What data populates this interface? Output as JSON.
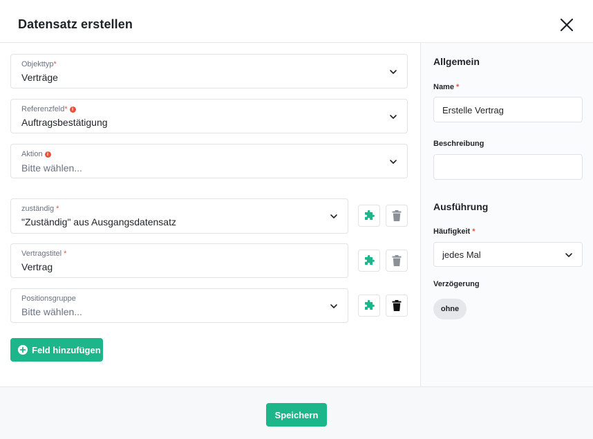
{
  "dialog": {
    "title": "Datensatz erstellen"
  },
  "left": {
    "fields": [
      {
        "label": "Objekttyp",
        "required": "*",
        "value": "Verträge"
      },
      {
        "label": "Referenzfeld",
        "required": "*",
        "info": "i",
        "value": "Auftragsbestätigung"
      },
      {
        "label": "Aktion",
        "info": "i",
        "value": "Bitte wählen..."
      },
      {
        "label": "zuständig",
        "required": " *",
        "value": "\"Zuständig\" aus Ausgangsdatensatz"
      },
      {
        "label": "Vertragstitel",
        "required": " *",
        "value": "Vertrag"
      },
      {
        "label": "Positionsgruppe",
        "value": "Bitte wählen..."
      }
    ],
    "add_field_label": "Feld hinzufügen"
  },
  "right": {
    "general_heading": "Allgemein",
    "name_label": "Name",
    "name_required": " *",
    "name_value": "Erstelle Vertrag",
    "description_label": "Beschreibung",
    "description_value": "",
    "execution_heading": "Ausführung",
    "frequency_label": "Häufigkeit",
    "frequency_required": " *",
    "frequency_value": "jedes Mal",
    "delay_label": "Verzögerung",
    "delay_value": "ohne"
  },
  "footer": {
    "save_label": "Speichern"
  },
  "colors": {
    "accent": "#1db58a",
    "required": "#e5533d",
    "trash_enabled": "#111111",
    "trash_disabled": "#8a8f98"
  },
  "icons": {
    "close": "close-icon",
    "chevron": "chevron-down-icon",
    "puzzle": "puzzle-icon",
    "trash": "trash-icon",
    "plus": "plus-circle-icon",
    "info": "info-icon"
  }
}
